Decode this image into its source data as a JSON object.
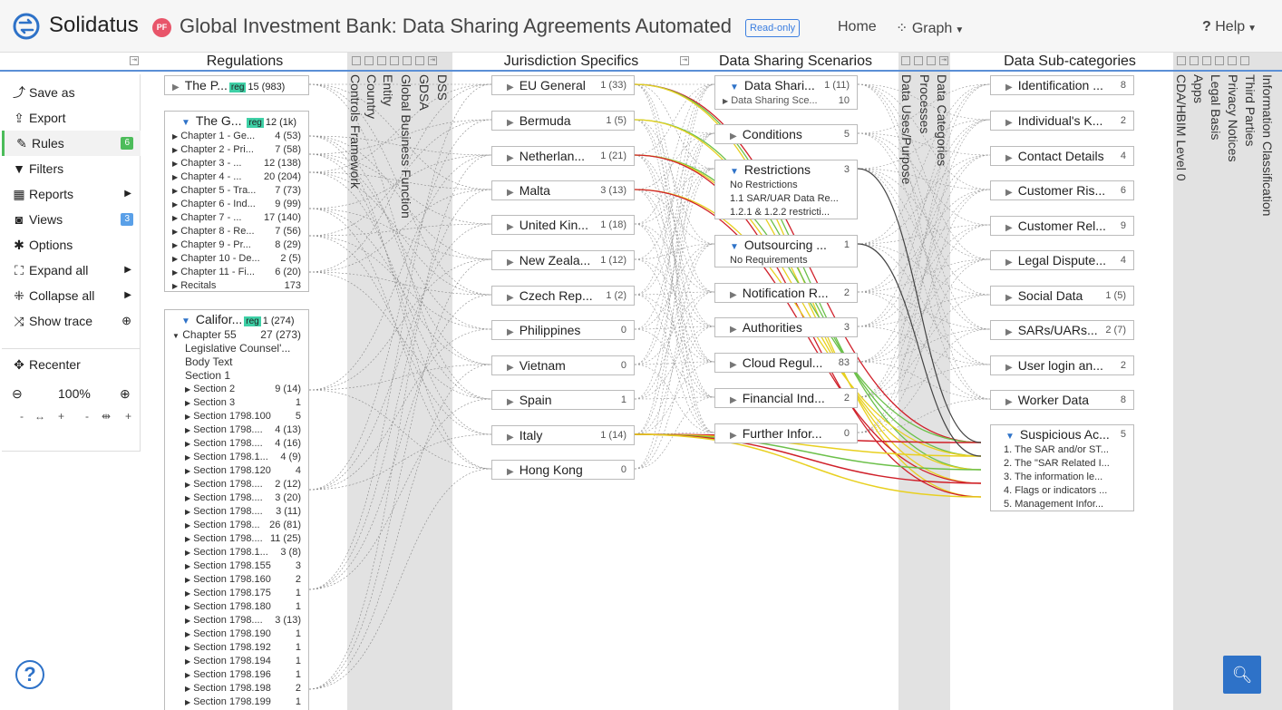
{
  "app": {
    "logo_text": "Solidatus",
    "user_initials": "PF",
    "model_title": "Global Investment Bank: Data Sharing Agreements Automated",
    "readonly_label": "Read-only",
    "nav": {
      "home": "Home",
      "graph": "Graph",
      "help": "Help"
    }
  },
  "columns": {
    "regulations": "Regulations",
    "jurisdiction": "Jurisdiction Specifics",
    "scenarios": "Data Sharing Scenarios",
    "subcategories": "Data Sub-categories"
  },
  "vertical_labels": {
    "group1": [
      "Controls Framework",
      "Country",
      "Entity",
      "Global Business Function",
      "GDSA",
      "DSS"
    ],
    "group2": [
      "Data Uses/Purpose",
      "Processes",
      "Data Categories"
    ],
    "group3": [
      "CDA/HBIM Level 0",
      "Apps",
      "Legal Basis",
      "Privacy Notices",
      "Third Parties",
      "Information Classification"
    ]
  },
  "sidebar": {
    "items": [
      {
        "label": "Save as",
        "icon": "save-as-icon",
        "glyph": "⤴"
      },
      {
        "label": "Export",
        "icon": "export-icon",
        "glyph": "⇪"
      },
      {
        "label": "Rules",
        "icon": "pencil-icon",
        "glyph": "✎",
        "count": "6"
      },
      {
        "label": "Filters",
        "icon": "filter-icon",
        "glyph": "▼"
      },
      {
        "label": "Reports",
        "icon": "table-icon",
        "glyph": "▦"
      },
      {
        "label": "Views",
        "icon": "camera-icon",
        "glyph": "◙",
        "count": "3"
      },
      {
        "label": "Options",
        "icon": "gear-icon",
        "glyph": "✱"
      },
      {
        "label": "Expand all",
        "icon": "expand-icon",
        "glyph": "⛶"
      },
      {
        "label": "Collapse all",
        "icon": "collapse-icon",
        "glyph": "⁜"
      },
      {
        "label": "Show trace",
        "icon": "shuffle-icon",
        "glyph": "⤨"
      }
    ],
    "recenter": "Recenter",
    "zoom": "100%"
  },
  "regulations": {
    "node1": {
      "label": "The P...",
      "tag": "reg",
      "count": "15 (983)"
    },
    "node2": {
      "label": "The G...",
      "tag": "reg",
      "count": "12 (1k)",
      "children": [
        {
          "label": "Chapter 1 - Ge...",
          "count": "4 (53)"
        },
        {
          "label": "Chapter 2 - Pri...",
          "count": "7 (58)"
        },
        {
          "label": "Chapter 3 - ...",
          "count": "12 (138)"
        },
        {
          "label": "Chapter 4 - ...",
          "count": "20 (204)"
        },
        {
          "label": "Chapter 5 - Tra...",
          "count": "7 (73)"
        },
        {
          "label": "Chapter 6 - Ind...",
          "count": "9 (99)"
        },
        {
          "label": "Chapter 7 - ...",
          "count": "17 (140)"
        },
        {
          "label": "Chapter 8 - Re...",
          "count": "7 (56)"
        },
        {
          "label": "Chapter 9 - Pr...",
          "count": "8 (29)"
        },
        {
          "label": "Chapter 10 - De...",
          "count": "2 (5)"
        },
        {
          "label": "Chapter 11 - Fi...",
          "count": "6 (20)"
        },
        {
          "label": "Recitals",
          "count": "173"
        }
      ]
    },
    "node3": {
      "label": "Califor...",
      "tag": "reg",
      "count": "1 (274)",
      "chapter": {
        "label": "Chapter 55",
        "count": "27 (273)"
      },
      "plain": [
        "Legislative Counsel'...",
        "Body Text",
        "Section 1"
      ],
      "sections": [
        {
          "label": "Section 2",
          "count": "9 (14)"
        },
        {
          "label": "Section 3",
          "count": "1"
        },
        {
          "label": "Section 1798.100",
          "count": "5"
        },
        {
          "label": "Section 1798....",
          "count": "4 (13)"
        },
        {
          "label": "Section 1798....",
          "count": "4 (16)"
        },
        {
          "label": "Section 1798.1...",
          "count": "4 (9)"
        },
        {
          "label": "Section 1798.120",
          "count": "4"
        },
        {
          "label": "Section 1798....",
          "count": "2 (12)"
        },
        {
          "label": "Section 1798....",
          "count": "3 (20)"
        },
        {
          "label": "Section 1798....",
          "count": "3 (11)"
        },
        {
          "label": "Section 1798...",
          "count": "26 (81)"
        },
        {
          "label": "Section 1798....",
          "count": "11 (25)"
        },
        {
          "label": "Section 1798.1...",
          "count": "3 (8)"
        },
        {
          "label": "Section 1798.155",
          "count": "3"
        },
        {
          "label": "Section 1798.160",
          "count": "2"
        },
        {
          "label": "Section 1798.175",
          "count": "1"
        },
        {
          "label": "Section 1798.180",
          "count": "1"
        },
        {
          "label": "Section 1798....",
          "count": "3 (13)"
        },
        {
          "label": "Section 1798.190",
          "count": "1"
        },
        {
          "label": "Section 1798.192",
          "count": "1"
        },
        {
          "label": "Section 1798.194",
          "count": "1"
        },
        {
          "label": "Section 1798.196",
          "count": "1"
        },
        {
          "label": "Section 1798.198",
          "count": "2"
        },
        {
          "label": "Section 1798.199",
          "count": "1"
        }
      ]
    }
  },
  "jurisdictions": [
    {
      "label": "EU General",
      "count": "1 (33)"
    },
    {
      "label": "Bermuda",
      "count": "1 (5)"
    },
    {
      "label": "Netherlan...",
      "count": "1 (21)"
    },
    {
      "label": "Malta",
      "count": "3 (13)"
    },
    {
      "label": "United Kin...",
      "count": "1 (18)"
    },
    {
      "label": "New Zeala...",
      "count": "1 (12)"
    },
    {
      "label": "Czech Rep...",
      "count": "1 (2)"
    },
    {
      "label": "Philippines",
      "count": "0"
    },
    {
      "label": "Vietnam",
      "count": "0"
    },
    {
      "label": "Spain",
      "count": "1"
    },
    {
      "label": "Italy",
      "count": "1 (14)"
    },
    {
      "label": "Hong Kong",
      "count": "0"
    }
  ],
  "scenarios": {
    "data_sharing": {
      "label": "Data Shari...",
      "count": "1 (11)",
      "child": "Data Sharing Sce...",
      "child_count": "10"
    },
    "conditions": {
      "label": "Conditions",
      "count": "5"
    },
    "restrictions": {
      "label": "Restrictions",
      "count": "3",
      "children": [
        "No Restrictions",
        "1.1 SAR/UAR Data Re...",
        "1.2.1 & 1.2.2 restricti..."
      ]
    },
    "outsourcing": {
      "label": "Outsourcing ...",
      "count": "1",
      "children": [
        "No Requirements"
      ]
    },
    "notification": {
      "label": "Notification R...",
      "count": "2"
    },
    "authorities": {
      "label": "Authorities",
      "count": "3"
    },
    "cloud": {
      "label": "Cloud Regul...",
      "count": "83"
    },
    "financial": {
      "label": "Financial Ind...",
      "count": "2"
    },
    "further": {
      "label": "Further Infor...",
      "count": "0"
    }
  },
  "subcategories": [
    {
      "label": "Identification ...",
      "count": "8"
    },
    {
      "label": "Individual's K...",
      "count": "2"
    },
    {
      "label": "Contact Details",
      "count": "4"
    },
    {
      "label": "Customer Ris...",
      "count": "6"
    },
    {
      "label": "Customer Rel...",
      "count": "9"
    },
    {
      "label": "Legal Dispute...",
      "count": "4"
    },
    {
      "label": "Social Data",
      "count": "1 (5)"
    },
    {
      "label": "SARs/UARs...",
      "count": "2 (7)"
    },
    {
      "label": "User login an...",
      "count": "2"
    },
    {
      "label": "Worker Data",
      "count": "8"
    }
  ],
  "suspicious": {
    "label": "Suspicious Ac...",
    "count": "5",
    "children": [
      "1. The SAR and/or ST...",
      "2. The \"SAR Related I...",
      "3. The information le...",
      "4. Flags or indicators ...",
      "5. Management Infor..."
    ]
  },
  "colors": {
    "accent": "#2e72c8",
    "reg_tag": "#3ed0a6",
    "trace_red": "#d0202a",
    "trace_yellow": "#e8d020",
    "trace_green": "#6cc04a"
  }
}
